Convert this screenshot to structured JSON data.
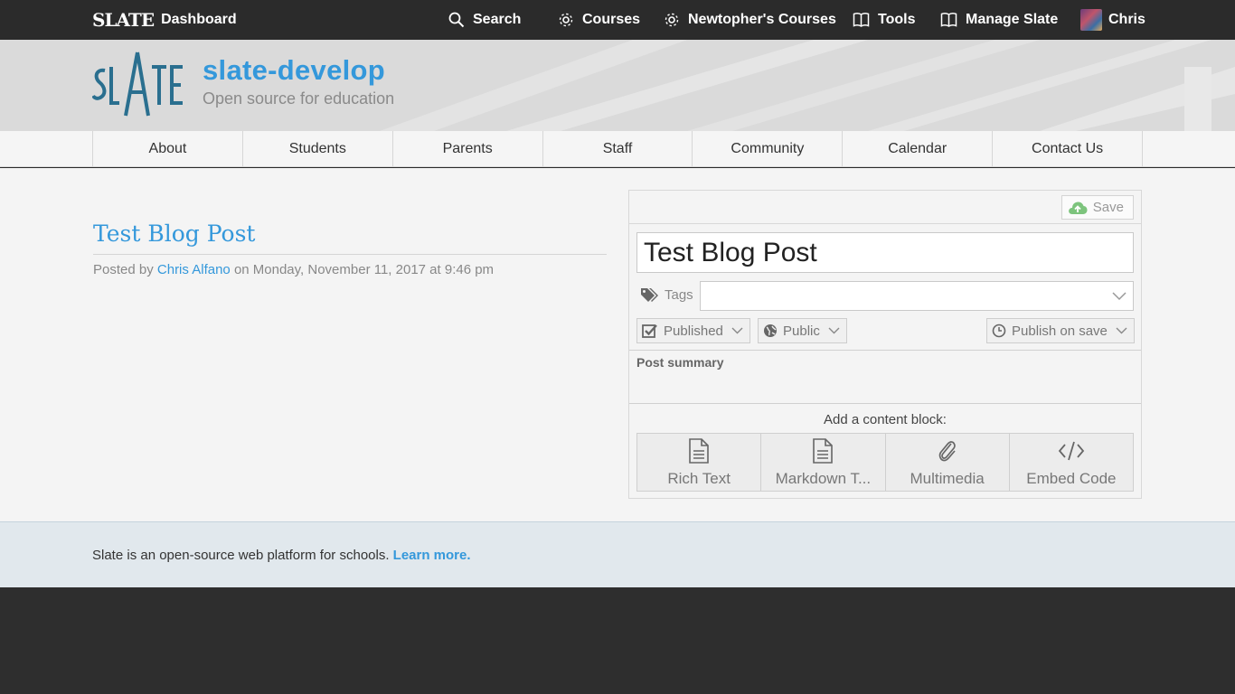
{
  "topbar": {
    "logo_text": "SLATE",
    "dashboard_label": "Dashboard",
    "nav": [
      {
        "label": "Search",
        "icon": "search-icon"
      },
      {
        "label": "Courses",
        "icon": "gear-icon"
      },
      {
        "label": "Newtopher's Courses",
        "icon": "gear-icon"
      },
      {
        "label": "Tools",
        "icon": "book-icon"
      },
      {
        "label": "Manage Slate",
        "icon": "book-icon"
      },
      {
        "label": "Chris",
        "icon": "avatar"
      }
    ]
  },
  "header": {
    "logo_text": "SLATE",
    "site_title": "slate-develop",
    "tagline": "Open source for education"
  },
  "main_nav": [
    "About",
    "Students",
    "Parents",
    "Staff",
    "Community",
    "Calendar",
    "Contact Us"
  ],
  "post": {
    "title": "Test Blog Post",
    "meta_prefix": "Posted by",
    "author": "Chris Alfano",
    "meta_suffix": "on Monday, November 11, 2017 at 9:46 pm"
  },
  "editor": {
    "save_label": "Save",
    "title_value": "Test Blog Post",
    "tags_label": "Tags",
    "tags_value": "",
    "status_label": "Published",
    "visibility_label": "Public",
    "publish_label": "Publish on save",
    "summary_label": "Post summary",
    "add_block_label": "Add a content block:",
    "blocks": [
      {
        "label": "Rich Text",
        "icon": "document-icon"
      },
      {
        "label": "Markdown T...",
        "icon": "document-icon"
      },
      {
        "label": "Multimedia",
        "icon": "paperclip-icon"
      },
      {
        "label": "Embed Code",
        "icon": "code-icon"
      }
    ]
  },
  "footer": {
    "text": "Slate is an open-source web platform for schools.",
    "link": "Learn more."
  },
  "colors": {
    "accent": "#3498db",
    "topbar": "#2b2b2b",
    "footer_bg": "#e1e8ed",
    "save_icon": "#7dc47d"
  }
}
